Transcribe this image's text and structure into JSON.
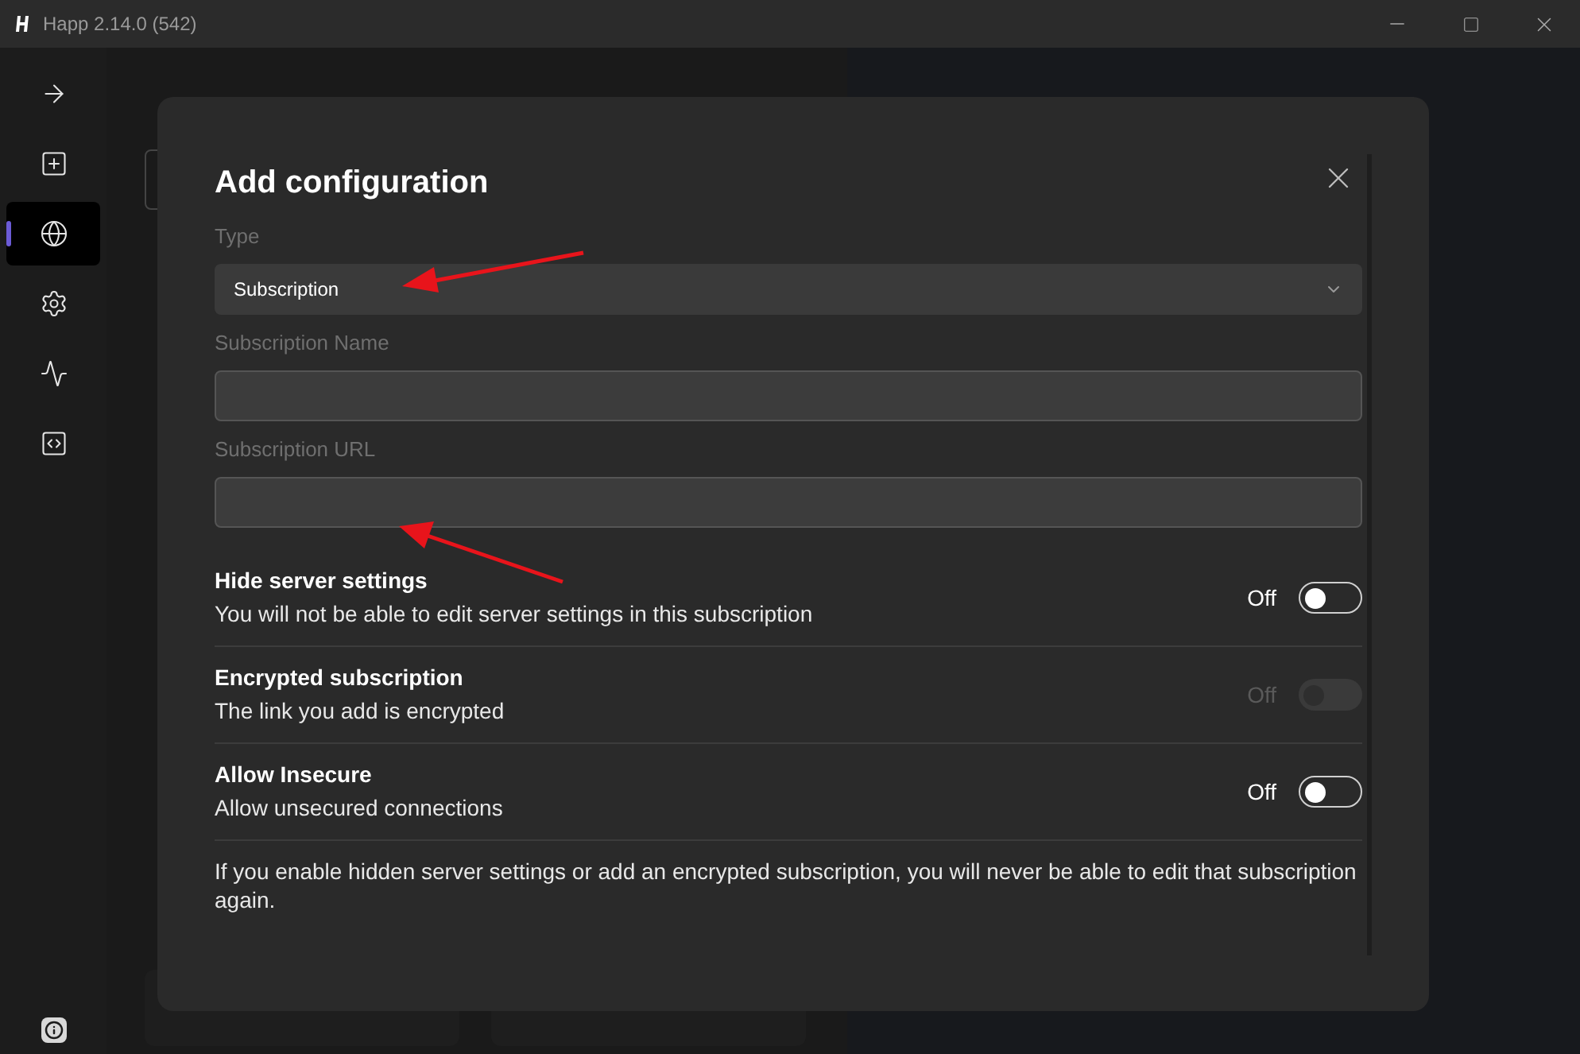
{
  "window": {
    "title": "Happ 2.14.0 (542)"
  },
  "sidebar": {
    "items": [
      {
        "selected": false
      },
      {
        "selected": false
      },
      {
        "selected": true
      },
      {
        "selected": false
      },
      {
        "selected": false
      },
      {
        "selected": false
      }
    ]
  },
  "dialog": {
    "title": "Add configuration",
    "fields": [
      {
        "kind": "select",
        "label": "Type",
        "value": "Subscription"
      },
      {
        "kind": "input",
        "label": "Subscription Name"
      },
      {
        "kind": "input",
        "label": "Subscription URL"
      }
    ],
    "toggles": [
      {
        "title": "Hide server settings",
        "description": "You will not be able to edit server settings in this subscription",
        "state_label": "Off",
        "on": false,
        "disabled": false
      },
      {
        "title": "Encrypted subscription",
        "description": "The link you add is encrypted",
        "state_label": "Off",
        "on": false,
        "disabled": true
      },
      {
        "title": "Allow Insecure",
        "description": "Allow unsecured connections",
        "state_label": "Off",
        "on": false,
        "disabled": false
      }
    ],
    "note": "If you enable hidden server settings or add an encrypted subscription, you will never be able to edit that subscription again."
  }
}
